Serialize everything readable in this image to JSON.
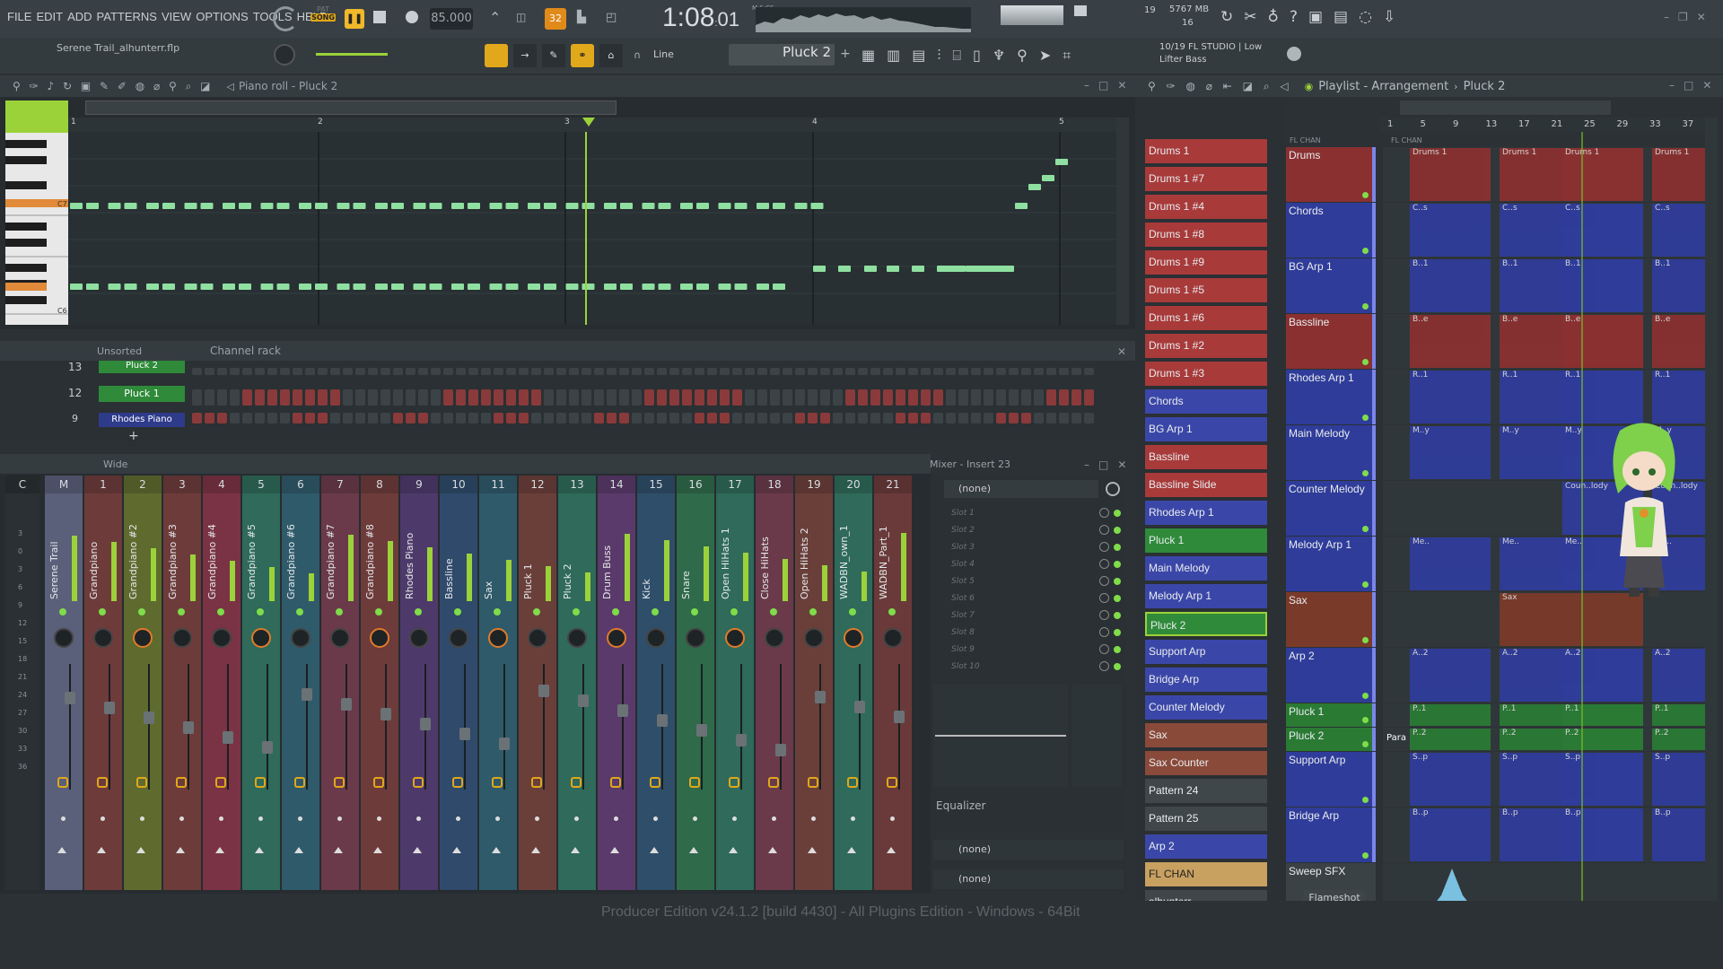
{
  "menu": [
    "FILE",
    "EDIT",
    "ADD",
    "PATTERNS",
    "VIEW",
    "OPTIONS",
    "TOOLS",
    "HELP"
  ],
  "transport": {
    "pat_label": "PAT",
    "song_label": "SONG",
    "tempo": "85.000",
    "time_main": "1:08",
    "time_sub": "01",
    "time_unit": "M:S:CS",
    "record_step": "32",
    "cpu_value": "19",
    "memory": "5767 MB",
    "poly": "16"
  },
  "project": {
    "file": "Serene Trail_alhunterr.flp",
    "hint_date": "10/19",
    "hint_text": "FL STUDIO | Low",
    "hint_sub": "Lifter Bass"
  },
  "toolbar": {
    "snap": "Line",
    "pattern": "Pluck 2"
  },
  "piano_roll": {
    "title": "Piano roll - Pluck 2",
    "bars": [
      "1",
      "2",
      "3",
      "4",
      "5"
    ],
    "octave_hi": "C7",
    "octave_lo": "C6"
  },
  "channel_rack": {
    "title": "Channel rack",
    "filter": "Unsorted",
    "rows": [
      {
        "num": "13",
        "name": "Pluck 2"
      },
      {
        "num": "12",
        "name": "Pluck 1"
      },
      {
        "num": "9",
        "name": "Rhodes Piano"
      }
    ]
  },
  "mixer": {
    "mode": "Wide",
    "insert_title": "Mixer - Insert 23",
    "input": "(none)",
    "equalizer": "Equalizer",
    "out1": "(none)",
    "out2": "(none)",
    "slots": [
      "Slot 1",
      "Slot 2",
      "Slot 3",
      "Slot 4",
      "Slot 5",
      "Slot 6",
      "Slot 7",
      "Slot 8",
      "Slot 9",
      "Slot 10"
    ],
    "scale": [
      "3",
      "0",
      "3",
      "6",
      "9",
      "12",
      "15",
      "18",
      "21",
      "24",
      "27",
      "30",
      "33",
      "36"
    ],
    "tracks": [
      {
        "num": "C",
        "name": "",
        "color": "#3a4246"
      },
      {
        "num": "M",
        "name": "Serene Trail",
        "color": "#5a5f7a"
      },
      {
        "num": "1",
        "name": "Grandpiano",
        "color": "#6e3b3b"
      },
      {
        "num": "2",
        "name": "Grandpiano #2",
        "color": "#5f6a2f"
      },
      {
        "num": "3",
        "name": "Grandpiano #3",
        "color": "#6e3b3b"
      },
      {
        "num": "4",
        "name": "Grandpiano #4",
        "color": "#7a3344"
      },
      {
        "num": "5",
        "name": "Grandpiano #5",
        "color": "#2f6a5a"
      },
      {
        "num": "6",
        "name": "Grandpiano #6",
        "color": "#2f5a6a"
      },
      {
        "num": "7",
        "name": "Grandpiano #7",
        "color": "#6a3a4a"
      },
      {
        "num": "8",
        "name": "Grandpiano #8",
        "color": "#6e3b3b"
      },
      {
        "num": "9",
        "name": "Rhodes Piano",
        "color": "#4e3a6a"
      },
      {
        "num": "10",
        "name": "Bassline",
        "color": "#2f4a6a"
      },
      {
        "num": "11",
        "name": "Sax",
        "color": "#2f5a6a"
      },
      {
        "num": "12",
        "name": "Pluck 1",
        "color": "#6a3f3a"
      },
      {
        "num": "13",
        "name": "Pluck 2",
        "color": "#2f6a5a"
      },
      {
        "num": "14",
        "name": "Drum Buss",
        "color": "#5a3a6a"
      },
      {
        "num": "15",
        "name": "Kick",
        "color": "#2f4e6a"
      },
      {
        "num": "16",
        "name": "Snare",
        "color": "#2f6a4a"
      },
      {
        "num": "17",
        "name": "Open HiHats 1",
        "color": "#2f6a5a"
      },
      {
        "num": "18",
        "name": "Close HiHats",
        "color": "#6a3a4a"
      },
      {
        "num": "19",
        "name": "Open HiHats 2",
        "color": "#6a3f3a"
      },
      {
        "num": "20",
        "name": "WADBN_own_1",
        "color": "#2f6a5a"
      },
      {
        "num": "21",
        "name": "WADBN_Part_1",
        "color": "#6a3a3a"
      }
    ]
  },
  "patterns": [
    {
      "name": "Drums 1",
      "color": "#a83a3a"
    },
    {
      "name": "Drums 1 #7",
      "color": "#a83a3a"
    },
    {
      "name": "Drums 1 #4",
      "color": "#a83a3a"
    },
    {
      "name": "Drums 1 #8",
      "color": "#a83a3a"
    },
    {
      "name": "Drums 1 #9",
      "color": "#a83a3a"
    },
    {
      "name": "Drums 1 #5",
      "color": "#a83a3a"
    },
    {
      "name": "Drums 1 #6",
      "color": "#a83a3a"
    },
    {
      "name": "Drums 1 #2",
      "color": "#a83a3a"
    },
    {
      "name": "Drums 1 #3",
      "color": "#a83a3a"
    },
    {
      "name": "Chords",
      "color": "#3b47a8"
    },
    {
      "name": "BG Arp 1",
      "color": "#3b47a8"
    },
    {
      "name": "Bassline",
      "color": "#a83a3a"
    },
    {
      "name": "Bassline Slide",
      "color": "#a83a3a"
    },
    {
      "name": "Rhodes Arp 1",
      "color": "#3b47a8"
    },
    {
      "name": "Pluck 1",
      "color": "#2f8a3a"
    },
    {
      "name": "Main Melody",
      "color": "#3b47a8"
    },
    {
      "name": "Melody Arp 1",
      "color": "#3b47a8"
    },
    {
      "name": "Pluck 2",
      "color": "#2f8a3a"
    },
    {
      "name": "Support Arp",
      "color": "#3b47a8"
    },
    {
      "name": "Bridge Arp",
      "color": "#3b47a8"
    },
    {
      "name": "Counter Melody",
      "color": "#3b47a8"
    },
    {
      "name": "Sax",
      "color": "#8a4a3a"
    },
    {
      "name": "Sax Counter",
      "color": "#8a4a3a"
    },
    {
      "name": "Pattern 24",
      "color": "#40474b"
    },
    {
      "name": "Pattern 25",
      "color": "#40474b"
    },
    {
      "name": "Arp 2",
      "color": "#3b47a8"
    },
    {
      "name": "FL CHAN",
      "color": "#c8a060"
    },
    {
      "name": "alhunterr",
      "color": "#40474b"
    }
  ],
  "playlist": {
    "title": "Playlist - Arrangement",
    "pattern": "Pluck 2",
    "header_tag": "FL CHAN",
    "track_header": "FL CHAN",
    "bars": [
      "1",
      "5",
      "9",
      "13",
      "17",
      "21",
      "25",
      "29",
      "33",
      "37"
    ],
    "tracks": [
      {
        "name": "Drums",
        "color": "#8a3030",
        "h": 62,
        "clip": "Drums 1"
      },
      {
        "name": "Chords",
        "color": "#2f3c9a",
        "h": 62,
        "clip": "C..s"
      },
      {
        "name": "BG Arp 1",
        "color": "#2f3c9a",
        "h": 62,
        "clip": "B..1"
      },
      {
        "name": "Bassline",
        "color": "#8a3030",
        "h": 62,
        "clip": "B..e"
      },
      {
        "name": "Rhodes Arp 1",
        "color": "#2f3c9a",
        "h": 62,
        "clip": "R..1"
      },
      {
        "name": "Main Melody",
        "color": "#2f3c9a",
        "h": 62,
        "clip": "M..y"
      },
      {
        "name": "Counter Melody",
        "color": "#2f3c9a",
        "h": 62,
        "clip": "Coun..lody"
      },
      {
        "name": "Melody Arp 1",
        "color": "#2f3c9a",
        "h": 62,
        "clip": "Me.."
      },
      {
        "name": "Sax",
        "color": "#7a3a2a",
        "h": 62,
        "clip": "Sax"
      },
      {
        "name": "Arp 2",
        "color": "#2f3c9a",
        "h": 62,
        "clip": "A..2"
      },
      {
        "name": "Pluck 1",
        "color": "#2a7a34",
        "h": 27,
        "clip": "P..1"
      },
      {
        "name": "Pluck 2",
        "color": "#2a7a34",
        "h": 27,
        "clip": "P..2"
      },
      {
        "name": "Support Arp",
        "color": "#2f3c9a",
        "h": 62,
        "clip": "S..p"
      },
      {
        "name": "Bridge Arp",
        "color": "#2f3c9a",
        "h": 62,
        "clip": "B..p"
      },
      {
        "name": "Sweep SFX",
        "color": "#3a4246",
        "h": 62,
        "clip": ""
      }
    ],
    "clip_label_para": "Para",
    "flameshot": "Flameshot"
  },
  "status": "Producer Edition v24.1.2 [build 4430] - All Plugins Edition - Windows - 64Bit"
}
